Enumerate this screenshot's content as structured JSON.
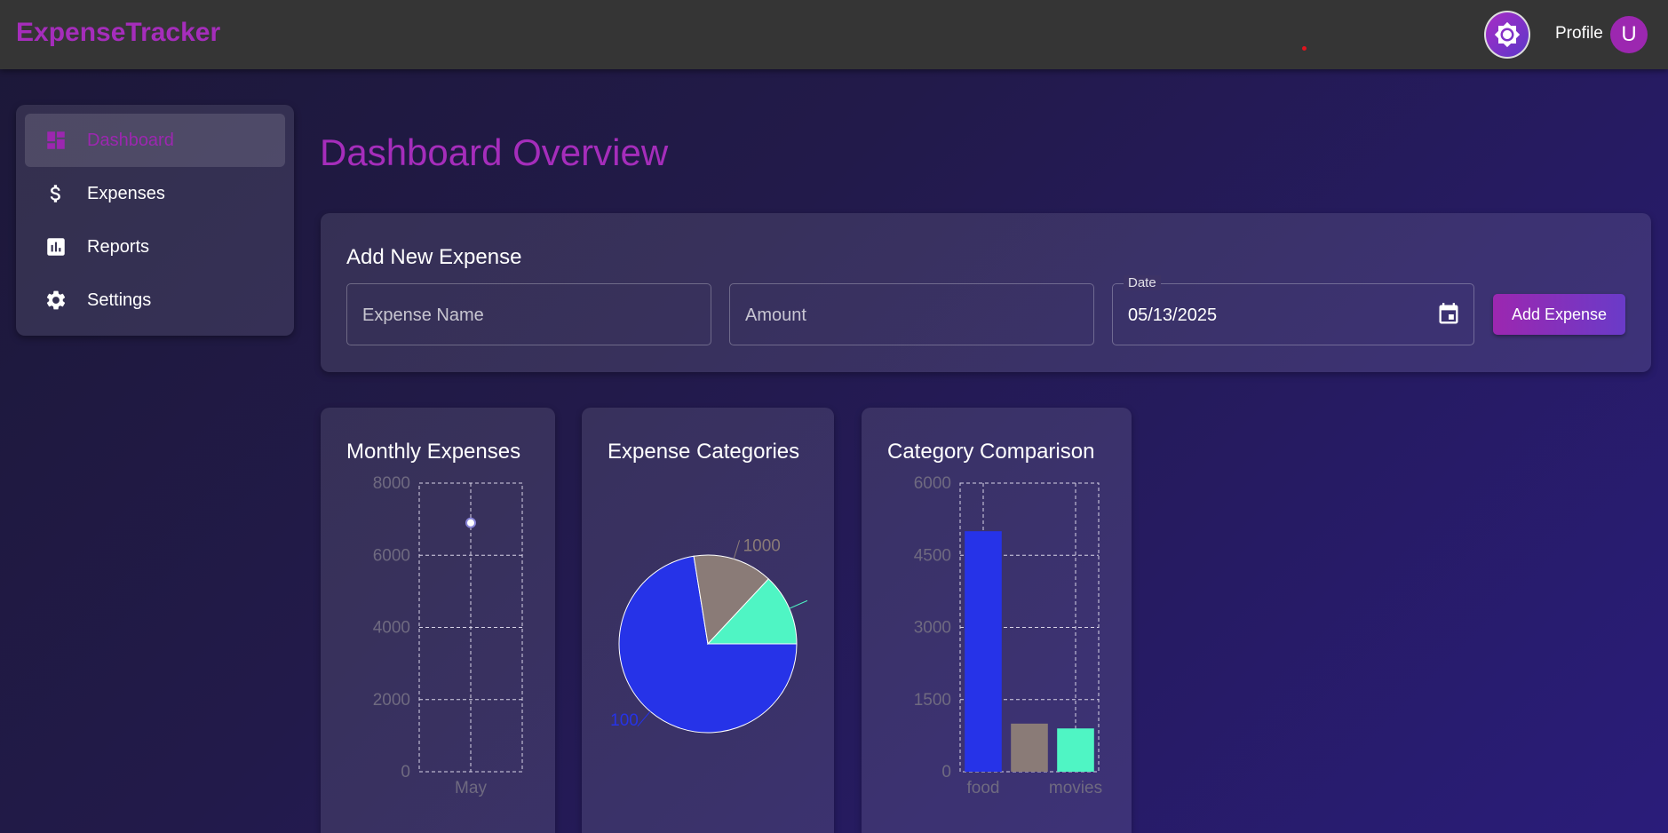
{
  "app": {
    "brand": "ExpenseTracker",
    "profile_label": "Profile",
    "avatar_initial": "U"
  },
  "sidebar": {
    "items": [
      {
        "label": "Dashboard",
        "icon": "dashboard-icon",
        "active": true
      },
      {
        "label": "Expenses",
        "icon": "dollar-icon",
        "active": false
      },
      {
        "label": "Reports",
        "icon": "bar-chart-icon",
        "active": false
      },
      {
        "label": "Settings",
        "icon": "gear-icon",
        "active": false
      }
    ]
  },
  "main": {
    "title": "Dashboard Overview",
    "form": {
      "title": "Add New Expense",
      "name_placeholder": "Expense Name",
      "amount_placeholder": "Amount",
      "date_label": "Date",
      "date_value": "05/13/2025",
      "submit_label": "Add Expense"
    }
  },
  "colors": {
    "accent": "#9c27b0",
    "food": "#2633e8",
    "gray": "#8a7b77",
    "movies": "#4ff5c4"
  },
  "chart_data": [
    {
      "type": "line",
      "title": "Monthly Expenses",
      "categories": [
        "May"
      ],
      "series": [
        {
          "values": [
            6900
          ]
        }
      ],
      "ylim": [
        0,
        8000
      ],
      "yticks": [
        "0",
        "2000",
        "4000",
        "6000",
        "8000"
      ],
      "grid": true
    },
    {
      "type": "pie",
      "title": "Expense Categories",
      "slices": [
        {
          "value": 5000,
          "color": "#2633e8"
        },
        {
          "value": 1000,
          "color": "#8a7b77"
        },
        {
          "value": 900,
          "color": "#4ff5c4"
        }
      ],
      "labels": [
        "100",
        "1000"
      ]
    },
    {
      "type": "bar",
      "title": "Category Comparison",
      "values": [
        5000,
        1000,
        900
      ],
      "colors": [
        "#2633e8",
        "#8a7b77",
        "#4ff5c4"
      ],
      "xticks": [
        "food",
        "movies"
      ],
      "ylim": [
        0,
        6000
      ],
      "yticks": [
        "0",
        "1500",
        "3000",
        "4500",
        "6000"
      ],
      "grid": true
    }
  ]
}
